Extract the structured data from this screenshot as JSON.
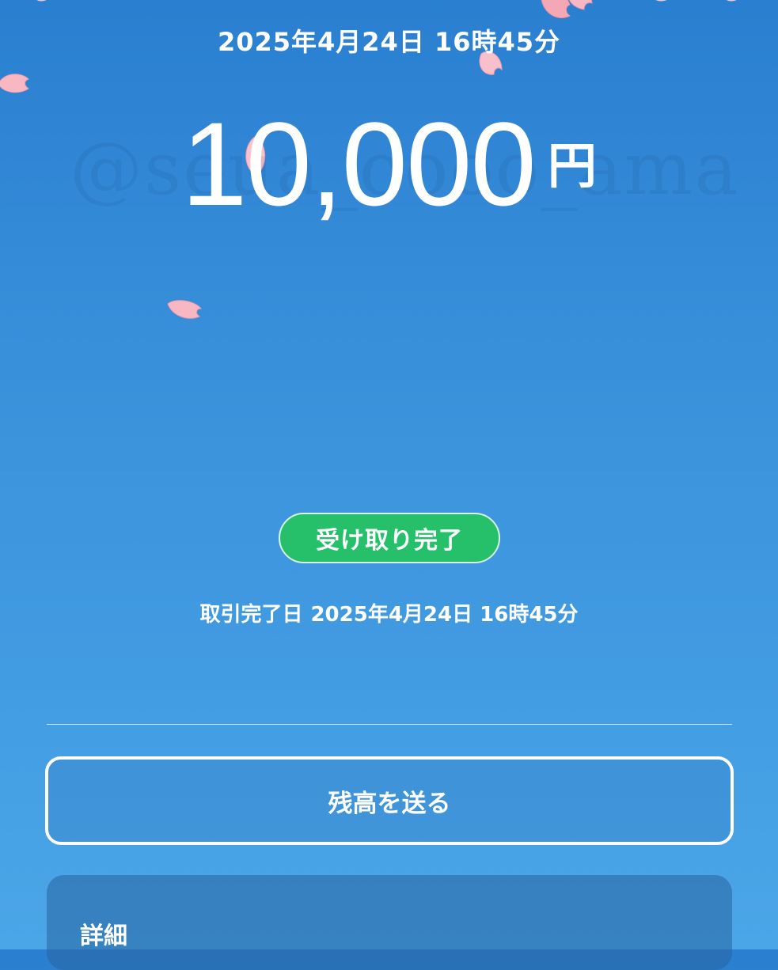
{
  "header": {
    "datetime": "2025年4月24日 16時45分"
  },
  "watermark": {
    "text": "@seua_oooo_ama"
  },
  "amount": {
    "value": "10,000",
    "currency": "円"
  },
  "status": {
    "label": "受け取り完了",
    "color": "#26c06a"
  },
  "transaction": {
    "completed_label": "取引完了日",
    "completed_datetime": "2025年4月24日 16時45分"
  },
  "actions": {
    "send_balance_label": "残高を送る"
  },
  "details": {
    "title": "詳細"
  },
  "theme": {
    "background_top": "#2a7fd0",
    "background_bottom": "#4ba6e8",
    "petal_color": "#f7b8c4"
  },
  "decorations": {
    "petal_icon": "cherry-blossom-petal-icon"
  }
}
